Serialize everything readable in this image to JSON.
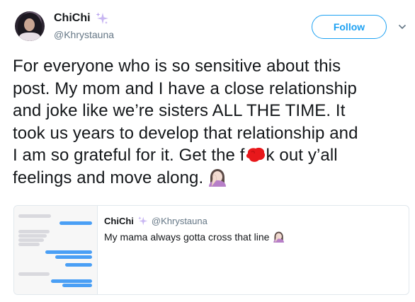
{
  "author": {
    "display_name": "ChiChi",
    "handle": "@Khrystauna",
    "name_icon": "sparkles-icon"
  },
  "actions": {
    "follow_label": "Follow",
    "menu_icon": "chevron-down-icon"
  },
  "tweet": {
    "lines": [
      "For everyone who is so sensitive about this",
      "post. My mom and I have a close relationship",
      "and joke like we’re sisters ALL THE TIME. It",
      "took us years to develop that relationship and",
      "I am so grateful for it. Get the f",
      "k out y’all",
      "feelings and move along."
    ],
    "censor_icon": "red-censor-blob-icon",
    "end_emoji": "woman-facepalming-emoji"
  },
  "quoted_tweet": {
    "display_name": "ChiChi",
    "handle": "@Khrystauna",
    "name_icon": "sparkles-icon",
    "text": "My mama always gotta cross that line",
    "end_emoji": "woman-facepalming-emoji",
    "media_icon": "text-message-screenshot-thumbnail"
  },
  "colors": {
    "accent": "#1da1f2",
    "text": "#14171a",
    "secondary": "#657786",
    "border": "#e1e8ed"
  }
}
